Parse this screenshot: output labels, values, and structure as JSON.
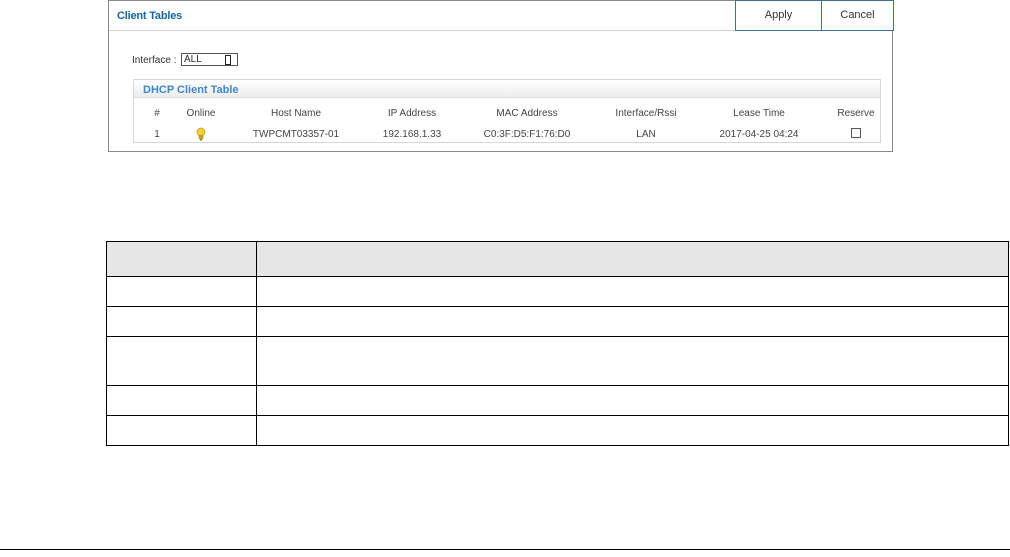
{
  "panel": {
    "title": "Client Tables",
    "apply_label": "Apply",
    "cancel_label": "Cancel"
  },
  "interface_filter": {
    "label": "Interface :",
    "value": "ALL"
  },
  "dhcp_table": {
    "title": "DHCP Client Table",
    "columns": [
      "#",
      "Online",
      "Host Name",
      "IP Address",
      "MAC Address",
      "Interface/Rssi",
      "Lease Time",
      "Reserve"
    ],
    "rows": [
      {
        "index": "1",
        "online_icon": "lightbulb-icon",
        "host_name": "TWPCMT03357-01",
        "ip_address": "192.168.1.33",
        "mac_address": "C0:3F:D5:F1:76:D0",
        "interface": "LAN",
        "lease_time": "2017-04-25 04:24",
        "reserve": false
      }
    ]
  },
  "colors": {
    "title_blue": "#1565a8",
    "section_blue": "#3f89c9",
    "button_border": "#3e6fa0",
    "online_bulb": "#f4cf3a",
    "header_row_bg": "#e6e6e6"
  }
}
